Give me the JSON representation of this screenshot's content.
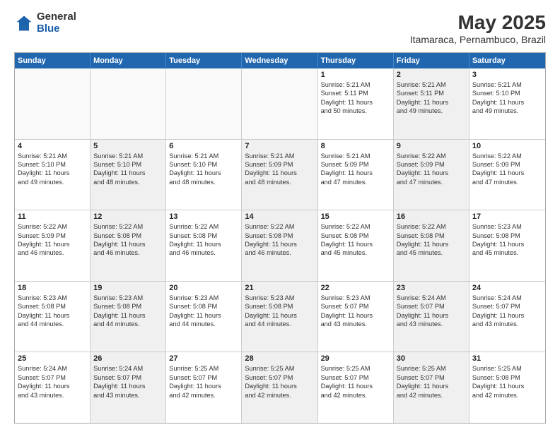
{
  "logo": {
    "general": "General",
    "blue": "Blue"
  },
  "title": "May 2025",
  "subtitle": "Itamaraca, Pernambuco, Brazil",
  "header_days": [
    "Sunday",
    "Monday",
    "Tuesday",
    "Wednesday",
    "Thursday",
    "Friday",
    "Saturday"
  ],
  "weeks": [
    [
      {
        "day": "",
        "text": "",
        "empty": true
      },
      {
        "day": "",
        "text": "",
        "empty": true
      },
      {
        "day": "",
        "text": "",
        "empty": true
      },
      {
        "day": "",
        "text": "",
        "empty": true
      },
      {
        "day": "1",
        "text": "Sunrise: 5:21 AM\nSunset: 5:11 PM\nDaylight: 11 hours\nand 50 minutes.",
        "shaded": false
      },
      {
        "day": "2",
        "text": "Sunrise: 5:21 AM\nSunset: 5:11 PM\nDaylight: 11 hours\nand 49 minutes.",
        "shaded": true
      },
      {
        "day": "3",
        "text": "Sunrise: 5:21 AM\nSunset: 5:10 PM\nDaylight: 11 hours\nand 49 minutes.",
        "shaded": false
      }
    ],
    [
      {
        "day": "4",
        "text": "Sunrise: 5:21 AM\nSunset: 5:10 PM\nDaylight: 11 hours\nand 49 minutes.",
        "shaded": false
      },
      {
        "day": "5",
        "text": "Sunrise: 5:21 AM\nSunset: 5:10 PM\nDaylight: 11 hours\nand 48 minutes.",
        "shaded": true
      },
      {
        "day": "6",
        "text": "Sunrise: 5:21 AM\nSunset: 5:10 PM\nDaylight: 11 hours\nand 48 minutes.",
        "shaded": false
      },
      {
        "day": "7",
        "text": "Sunrise: 5:21 AM\nSunset: 5:09 PM\nDaylight: 11 hours\nand 48 minutes.",
        "shaded": true
      },
      {
        "day": "8",
        "text": "Sunrise: 5:21 AM\nSunset: 5:09 PM\nDaylight: 11 hours\nand 47 minutes.",
        "shaded": false
      },
      {
        "day": "9",
        "text": "Sunrise: 5:22 AM\nSunset: 5:09 PM\nDaylight: 11 hours\nand 47 minutes.",
        "shaded": true
      },
      {
        "day": "10",
        "text": "Sunrise: 5:22 AM\nSunset: 5:09 PM\nDaylight: 11 hours\nand 47 minutes.",
        "shaded": false
      }
    ],
    [
      {
        "day": "11",
        "text": "Sunrise: 5:22 AM\nSunset: 5:09 PM\nDaylight: 11 hours\nand 46 minutes.",
        "shaded": false
      },
      {
        "day": "12",
        "text": "Sunrise: 5:22 AM\nSunset: 5:08 PM\nDaylight: 11 hours\nand 46 minutes.",
        "shaded": true
      },
      {
        "day": "13",
        "text": "Sunrise: 5:22 AM\nSunset: 5:08 PM\nDaylight: 11 hours\nand 46 minutes.",
        "shaded": false
      },
      {
        "day": "14",
        "text": "Sunrise: 5:22 AM\nSunset: 5:08 PM\nDaylight: 11 hours\nand 46 minutes.",
        "shaded": true
      },
      {
        "day": "15",
        "text": "Sunrise: 5:22 AM\nSunset: 5:08 PM\nDaylight: 11 hours\nand 45 minutes.",
        "shaded": false
      },
      {
        "day": "16",
        "text": "Sunrise: 5:22 AM\nSunset: 5:08 PM\nDaylight: 11 hours\nand 45 minutes.",
        "shaded": true
      },
      {
        "day": "17",
        "text": "Sunrise: 5:23 AM\nSunset: 5:08 PM\nDaylight: 11 hours\nand 45 minutes.",
        "shaded": false
      }
    ],
    [
      {
        "day": "18",
        "text": "Sunrise: 5:23 AM\nSunset: 5:08 PM\nDaylight: 11 hours\nand 44 minutes.",
        "shaded": false
      },
      {
        "day": "19",
        "text": "Sunrise: 5:23 AM\nSunset: 5:08 PM\nDaylight: 11 hours\nand 44 minutes.",
        "shaded": true
      },
      {
        "day": "20",
        "text": "Sunrise: 5:23 AM\nSunset: 5:08 PM\nDaylight: 11 hours\nand 44 minutes.",
        "shaded": false
      },
      {
        "day": "21",
        "text": "Sunrise: 5:23 AM\nSunset: 5:08 PM\nDaylight: 11 hours\nand 44 minutes.",
        "shaded": true
      },
      {
        "day": "22",
        "text": "Sunrise: 5:23 AM\nSunset: 5:07 PM\nDaylight: 11 hours\nand 43 minutes.",
        "shaded": false
      },
      {
        "day": "23",
        "text": "Sunrise: 5:24 AM\nSunset: 5:07 PM\nDaylight: 11 hours\nand 43 minutes.",
        "shaded": true
      },
      {
        "day": "24",
        "text": "Sunrise: 5:24 AM\nSunset: 5:07 PM\nDaylight: 11 hours\nand 43 minutes.",
        "shaded": false
      }
    ],
    [
      {
        "day": "25",
        "text": "Sunrise: 5:24 AM\nSunset: 5:07 PM\nDaylight: 11 hours\nand 43 minutes.",
        "shaded": false
      },
      {
        "day": "26",
        "text": "Sunrise: 5:24 AM\nSunset: 5:07 PM\nDaylight: 11 hours\nand 43 minutes.",
        "shaded": true
      },
      {
        "day": "27",
        "text": "Sunrise: 5:25 AM\nSunset: 5:07 PM\nDaylight: 11 hours\nand 42 minutes.",
        "shaded": false
      },
      {
        "day": "28",
        "text": "Sunrise: 5:25 AM\nSunset: 5:07 PM\nDaylight: 11 hours\nand 42 minutes.",
        "shaded": true
      },
      {
        "day": "29",
        "text": "Sunrise: 5:25 AM\nSunset: 5:07 PM\nDaylight: 11 hours\nand 42 minutes.",
        "shaded": false
      },
      {
        "day": "30",
        "text": "Sunrise: 5:25 AM\nSunset: 5:07 PM\nDaylight: 11 hours\nand 42 minutes.",
        "shaded": true
      },
      {
        "day": "31",
        "text": "Sunrise: 5:25 AM\nSunset: 5:08 PM\nDaylight: 11 hours\nand 42 minutes.",
        "shaded": false
      }
    ]
  ]
}
